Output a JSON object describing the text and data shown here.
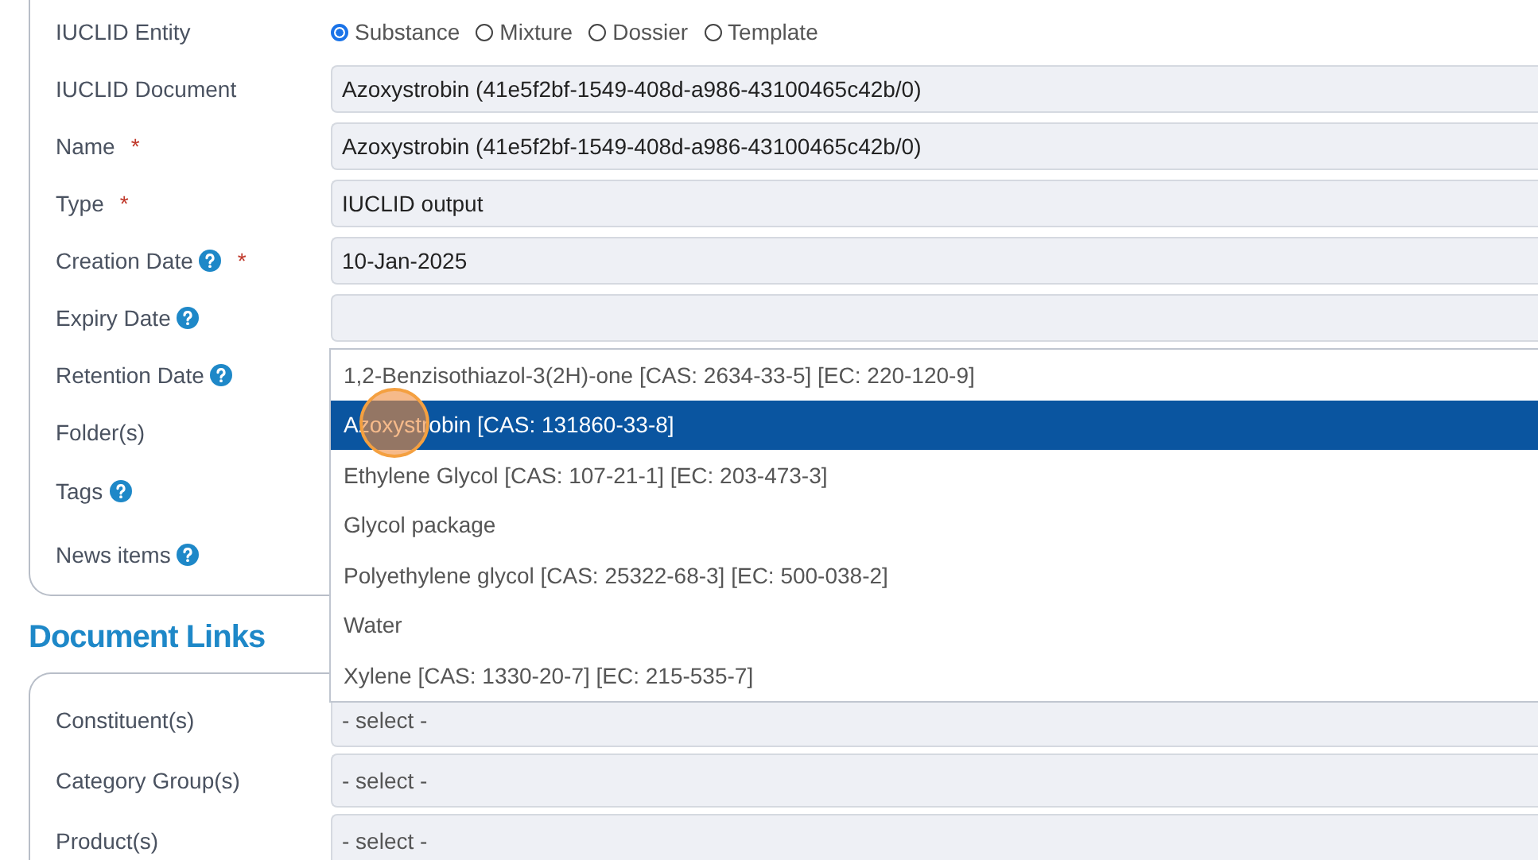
{
  "general_fields": [
    {
      "kind": "radio",
      "label": "IUCLID Entity",
      "options": [
        {
          "label": "Substance",
          "selected": true
        },
        {
          "label": "Mixture",
          "selected": false
        },
        {
          "label": "Dossier",
          "selected": false
        },
        {
          "label": "Template",
          "selected": false
        }
      ]
    },
    {
      "kind": "input",
      "label": "IUCLID Document",
      "value": "Azoxystrobin (41e5f2bf-1549-408d-a986-43100465c42b/0)"
    },
    {
      "kind": "input",
      "label": "Name",
      "required_mark": "*",
      "value": "Azoxystrobin (41e5f2bf-1549-408d-a986-43100465c42b/0)"
    },
    {
      "kind": "input",
      "label": "Type",
      "required_mark": "*",
      "value": "IUCLID output"
    },
    {
      "kind": "input",
      "label": "Creation Date",
      "help": true,
      "required_mark": "*",
      "value": "10-Jan-2025"
    },
    {
      "kind": "input",
      "label": "Expiry Date",
      "help": true
    },
    {
      "kind": "dropdown",
      "label": "Retention Date",
      "help": true,
      "options": [
        {
          "label": "1,2-Benzisothiazol-3(2H)-one [CAS: 2634-33-5] [EC: 220-120-9]",
          "selected": false
        },
        {
          "label": "Azoxystrobin [CAS: 131860-33-8]",
          "selected": true
        },
        {
          "label": "Ethylene Glycol [CAS: 107-21-1] [EC: 203-473-3]",
          "selected": false
        },
        {
          "label": "Glycol package",
          "selected": false
        },
        {
          "label": "Polyethylene glycol [CAS: 25322-68-3] [EC: 500-038-2]",
          "selected": false
        },
        {
          "label": "Water",
          "selected": false
        },
        {
          "label": "Xylene [CAS: 1330-20-7] [EC: 215-535-7]",
          "selected": false
        }
      ]
    },
    {
      "kind": "covered",
      "label": "Folder(s)"
    },
    {
      "kind": "covered",
      "label": "Tags",
      "help": true
    },
    {
      "kind": "covered",
      "label": "News items",
      "help": true
    }
  ],
  "document_links": {
    "title": "Document Links",
    "fields": [
      {
        "kind": "select",
        "label": "Constituent(s)",
        "placeholder": "- select -"
      },
      {
        "kind": "select",
        "label": "Category Group(s)",
        "placeholder": "- select -"
      },
      {
        "kind": "select",
        "label": "Product(s)",
        "placeholder": "- select -"
      }
    ]
  }
}
